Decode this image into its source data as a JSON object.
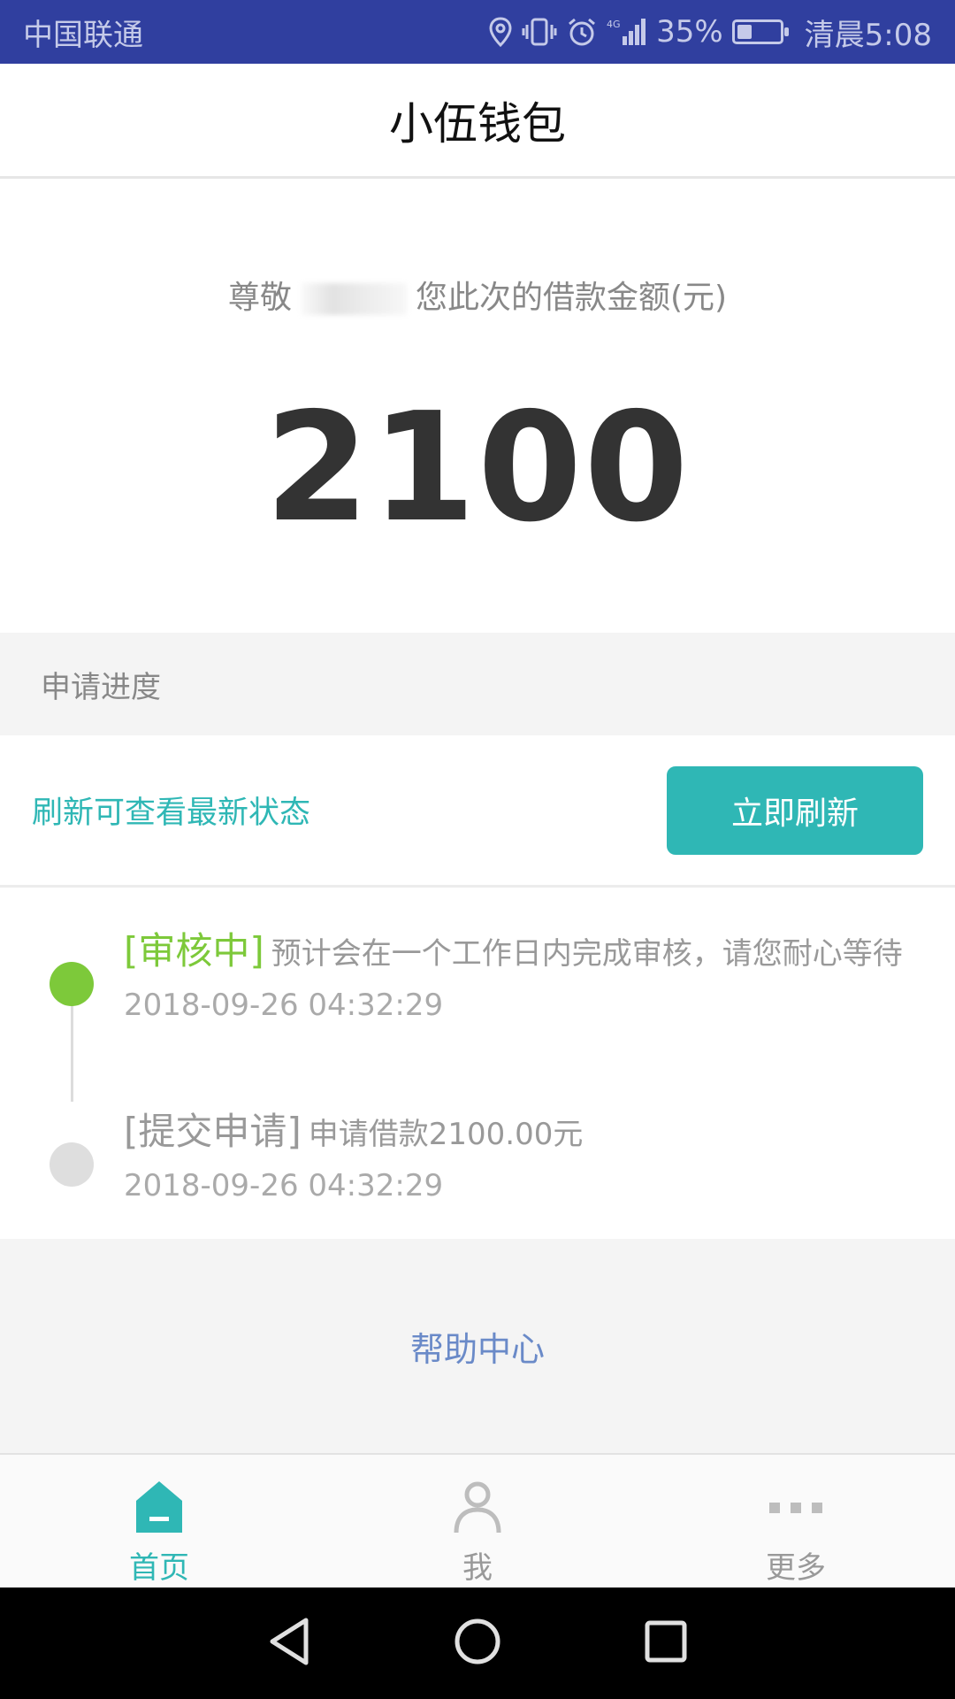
{
  "status_bar": {
    "carrier": "中国联通",
    "battery_percent": "35%",
    "battery_level": 0.35,
    "time": "清晨5:08",
    "icons": [
      "location-icon",
      "vibrate-icon",
      "alarm-icon",
      "signal-4g-icon",
      "battery-icon"
    ]
  },
  "header": {
    "title": "小伍钱包"
  },
  "loan": {
    "greeting_prefix": "尊敬",
    "greeting_suffix": "您此次的借款金额(元)",
    "amount": "2100"
  },
  "progress": {
    "section_title": "申请进度",
    "refresh_hint": "刷新可查看最新状态",
    "refresh_button": "立即刷新",
    "items": [
      {
        "status": "[审核中]",
        "description": "预计会在一个工作日内完成审核，请您耐心等待",
        "time": "2018-09-26 04:32:29"
      },
      {
        "status": "[提交申请]",
        "description": "申请借款2100.00元",
        "time": "2018-09-26 04:32:29"
      }
    ]
  },
  "help": {
    "label": "帮助中心"
  },
  "bottom_nav": {
    "items": [
      {
        "label": "首页",
        "icon": "home-icon",
        "active": true
      },
      {
        "label": "我",
        "icon": "person-icon",
        "active": false
      },
      {
        "label": "更多",
        "icon": "more-icon",
        "active": false
      }
    ]
  },
  "colors": {
    "status_bar_bg": "#303f9f",
    "accent": "#2fb7b5",
    "status_green": "#7dc93a",
    "link_blue": "#6a8ac8"
  }
}
